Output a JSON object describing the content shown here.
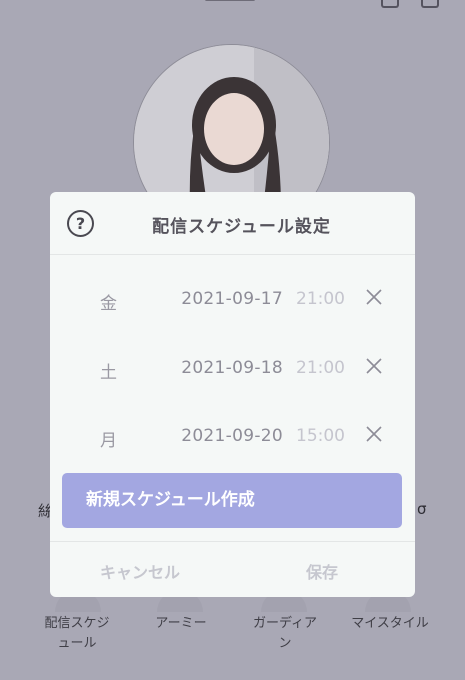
{
  "modal": {
    "title": "配信スケジュール設定",
    "help_icon": "question-circle-icon",
    "schedules": [
      {
        "day": "金",
        "date": "2021-09-17",
        "time": "21:00"
      },
      {
        "day": "土",
        "date": "2021-09-18",
        "time": "21:00"
      },
      {
        "day": "月",
        "date": "2021-09-20",
        "time": "15:00"
      }
    ],
    "remove_icon": "close-icon",
    "new_schedule_label": "新規スケジュール作成",
    "cancel_label": "キャンセル",
    "save_label": "保存"
  },
  "background": {
    "left_char": "絲",
    "right_char": "σ",
    "menu": [
      {
        "line1": "配信スケジ",
        "line2": "ュール"
      },
      {
        "line1": "アーミー",
        "line2": ""
      },
      {
        "line1": "ガーディア",
        "line2": "ン"
      },
      {
        "line1": "マイスタイル",
        "line2": ""
      }
    ]
  },
  "colors": {
    "overlay": "#a9a8b5",
    "modal_bg": "#f5f8f7",
    "primary_button": "#a3a7e1",
    "muted_text": "#c6c7cf"
  }
}
